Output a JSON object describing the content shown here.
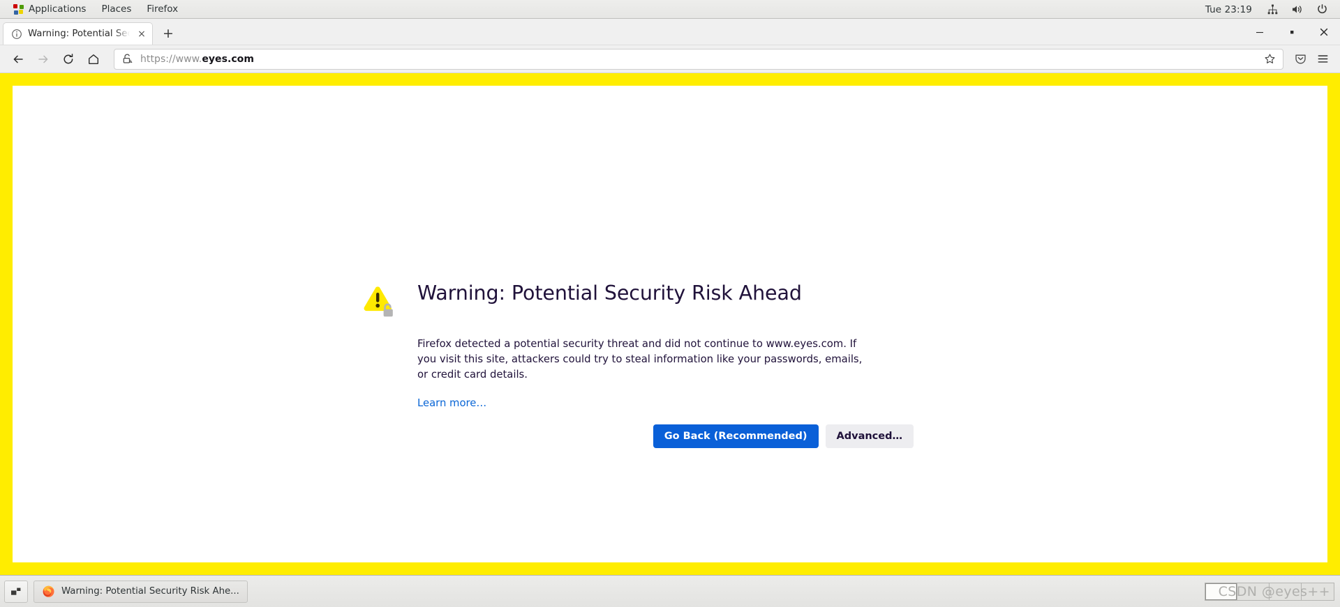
{
  "desktop": {
    "panel": {
      "applications_label": "Applications",
      "places_label": "Places",
      "firefox_label": "Firefox",
      "clock": "Tue 23:19",
      "network_icon": "network-icon",
      "volume_icon": "volume-icon",
      "power_icon": "power-icon"
    },
    "taskbar": {
      "show_desktop_icon": "show-desktop-icon",
      "window_button_label": "Warning: Potential Security Risk Ahe...",
      "workspaces": [
        {
          "name": "workspace-1",
          "active": true
        },
        {
          "name": "workspace-2",
          "active": false
        },
        {
          "name": "workspace-3",
          "active": false
        },
        {
          "name": "workspace-4",
          "active": false
        }
      ],
      "watermark": "CSDN @eyes++"
    }
  },
  "browser": {
    "tab": {
      "title": "Warning: Potential Securit",
      "favicon": "info-circle-icon",
      "close_label": "×"
    },
    "new_tab_label": "+",
    "window_controls": {
      "minimize": "minimize-icon",
      "maximize": "maximize-icon",
      "close": "close-icon"
    },
    "nav": {
      "back_icon": "back-arrow-icon",
      "forward_icon": "forward-arrow-icon",
      "reload_icon": "reload-icon",
      "home_icon": "home-icon"
    },
    "urlbar": {
      "scheme": "https://www.",
      "domain": "eyes.com",
      "full_url": "https://www.eyes.com",
      "security_icon": "broken-lock-warning-icon",
      "bookmark_icon": "star-icon"
    },
    "toolbar": {
      "pocket_icon": "pocket-icon",
      "menu_icon": "hamburger-menu-icon"
    }
  },
  "error_page": {
    "warning_icon": "warning-triangle-padlock-icon",
    "title": "Warning: Potential Security Risk Ahead",
    "description": "Firefox detected a potential security threat and did not continue to www.eyes.com. If you visit this site, attackers could try to steal information like your passwords, emails, or credit card details.",
    "learn_more_label": "Learn more…",
    "go_back_label": "Go Back (Recommended)",
    "advanced_label": "Advanced…"
  },
  "colors": {
    "border_warning_yellow": "#ffed00",
    "primary_button_blue": "#0a60d8",
    "link_blue": "#0a66d6",
    "icon_yellow": "#ffe900"
  }
}
